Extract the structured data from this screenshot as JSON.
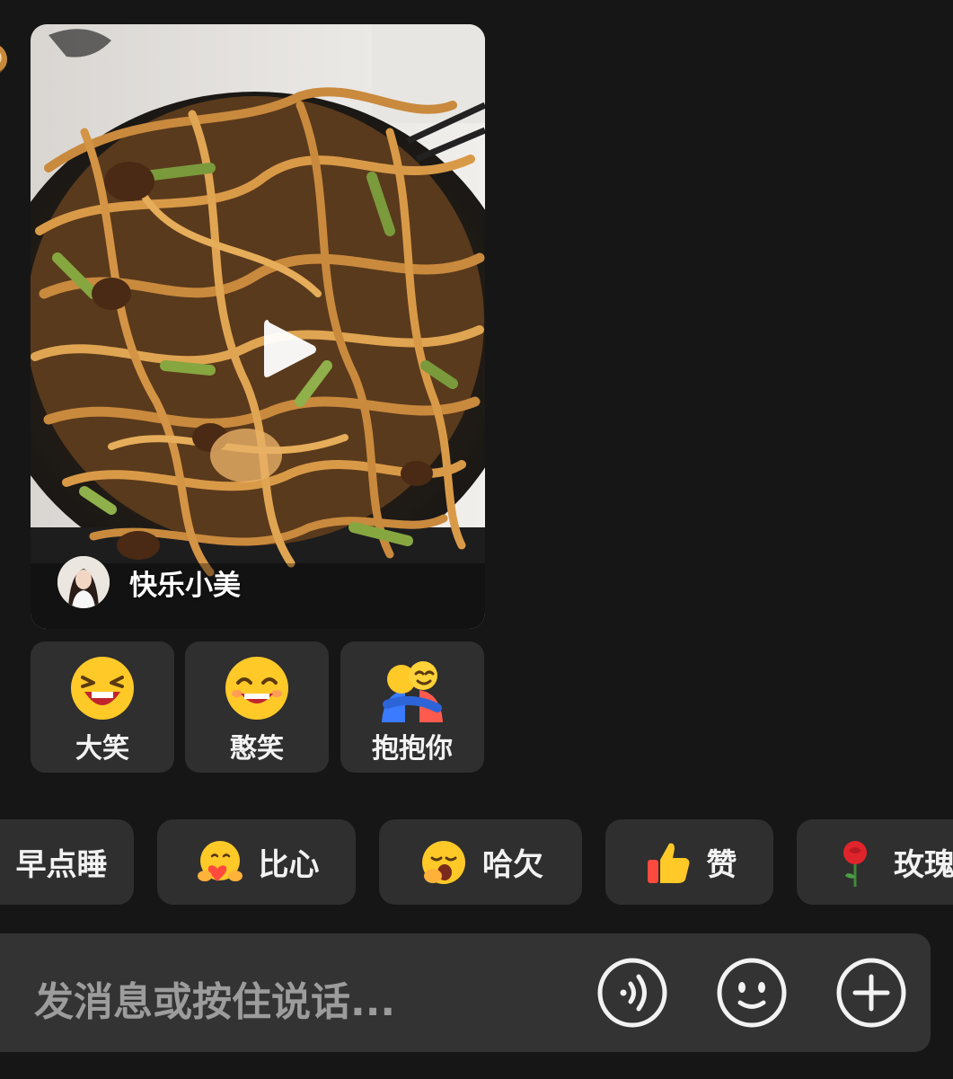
{
  "message": {
    "author_name": "快乐小美"
  },
  "reactions": [
    {
      "label": "大笑",
      "icon": "laughing-face-icon"
    },
    {
      "label": "憨笑",
      "icon": "grinning-face-icon"
    },
    {
      "label": "抱抱你",
      "icon": "hug-icon"
    }
  ],
  "quick_replies": [
    {
      "label": "早点睡",
      "icon": ""
    },
    {
      "label": "比心",
      "icon": "heart-hands-icon"
    },
    {
      "label": "哈欠",
      "icon": "yawning-face-icon"
    },
    {
      "label": "赞",
      "icon": "thumbs-up-icon"
    },
    {
      "label": "玫瑰",
      "icon": "rose-icon"
    }
  ],
  "composer": {
    "placeholder": "发消息或按住说话..."
  },
  "colors": {
    "background": "#161616",
    "chip": "#2f2f2f",
    "input_bar": "#333333",
    "placeholder": "#9c9c9c"
  }
}
